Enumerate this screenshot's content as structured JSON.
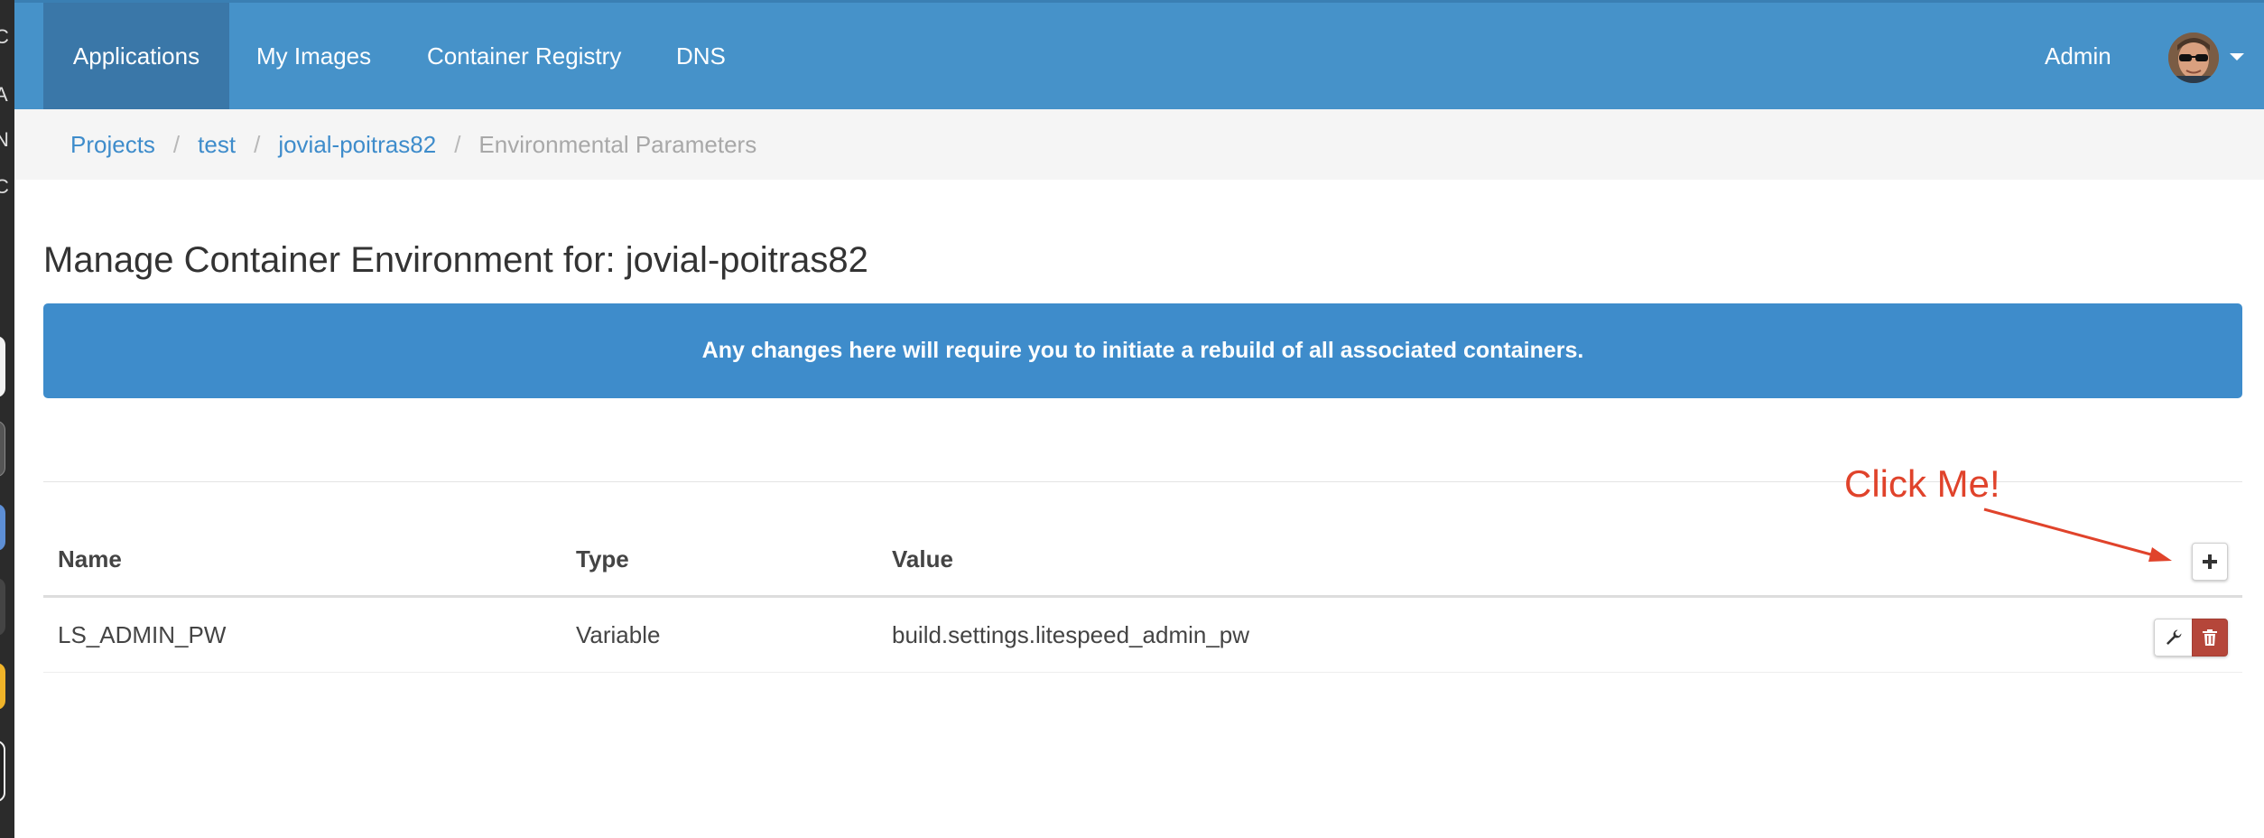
{
  "navbar": {
    "items": [
      {
        "label": "Applications",
        "active": true
      },
      {
        "label": "My Images"
      },
      {
        "label": "Container Registry"
      },
      {
        "label": "DNS"
      }
    ],
    "user_label": "Admin",
    "accent_color": "#4692c9"
  },
  "breadcrumb": {
    "items": [
      "Projects",
      "test",
      "jovial-poitras82"
    ],
    "current": "Environmental Parameters"
  },
  "page": {
    "title": "Manage Container Environment for: jovial-poitras82",
    "alert": "Any changes here will require you to initiate a rebuild of all associated containers."
  },
  "annotation": {
    "text": "Click Me!",
    "color": "#e0432b"
  },
  "table": {
    "headers": [
      "Name",
      "Type",
      "Value"
    ],
    "rows": [
      {
        "name": "LS_ADMIN_PW",
        "type": "Variable",
        "value": "build.settings.litespeed_admin_pw"
      }
    ],
    "add_icon": "plus-icon",
    "row_actions": [
      "wrench-icon",
      "trash-icon"
    ],
    "delete_color": "#b5463a"
  },
  "background_window": {
    "visible_letters": [
      "C",
      "A",
      "N",
      "C"
    ]
  }
}
